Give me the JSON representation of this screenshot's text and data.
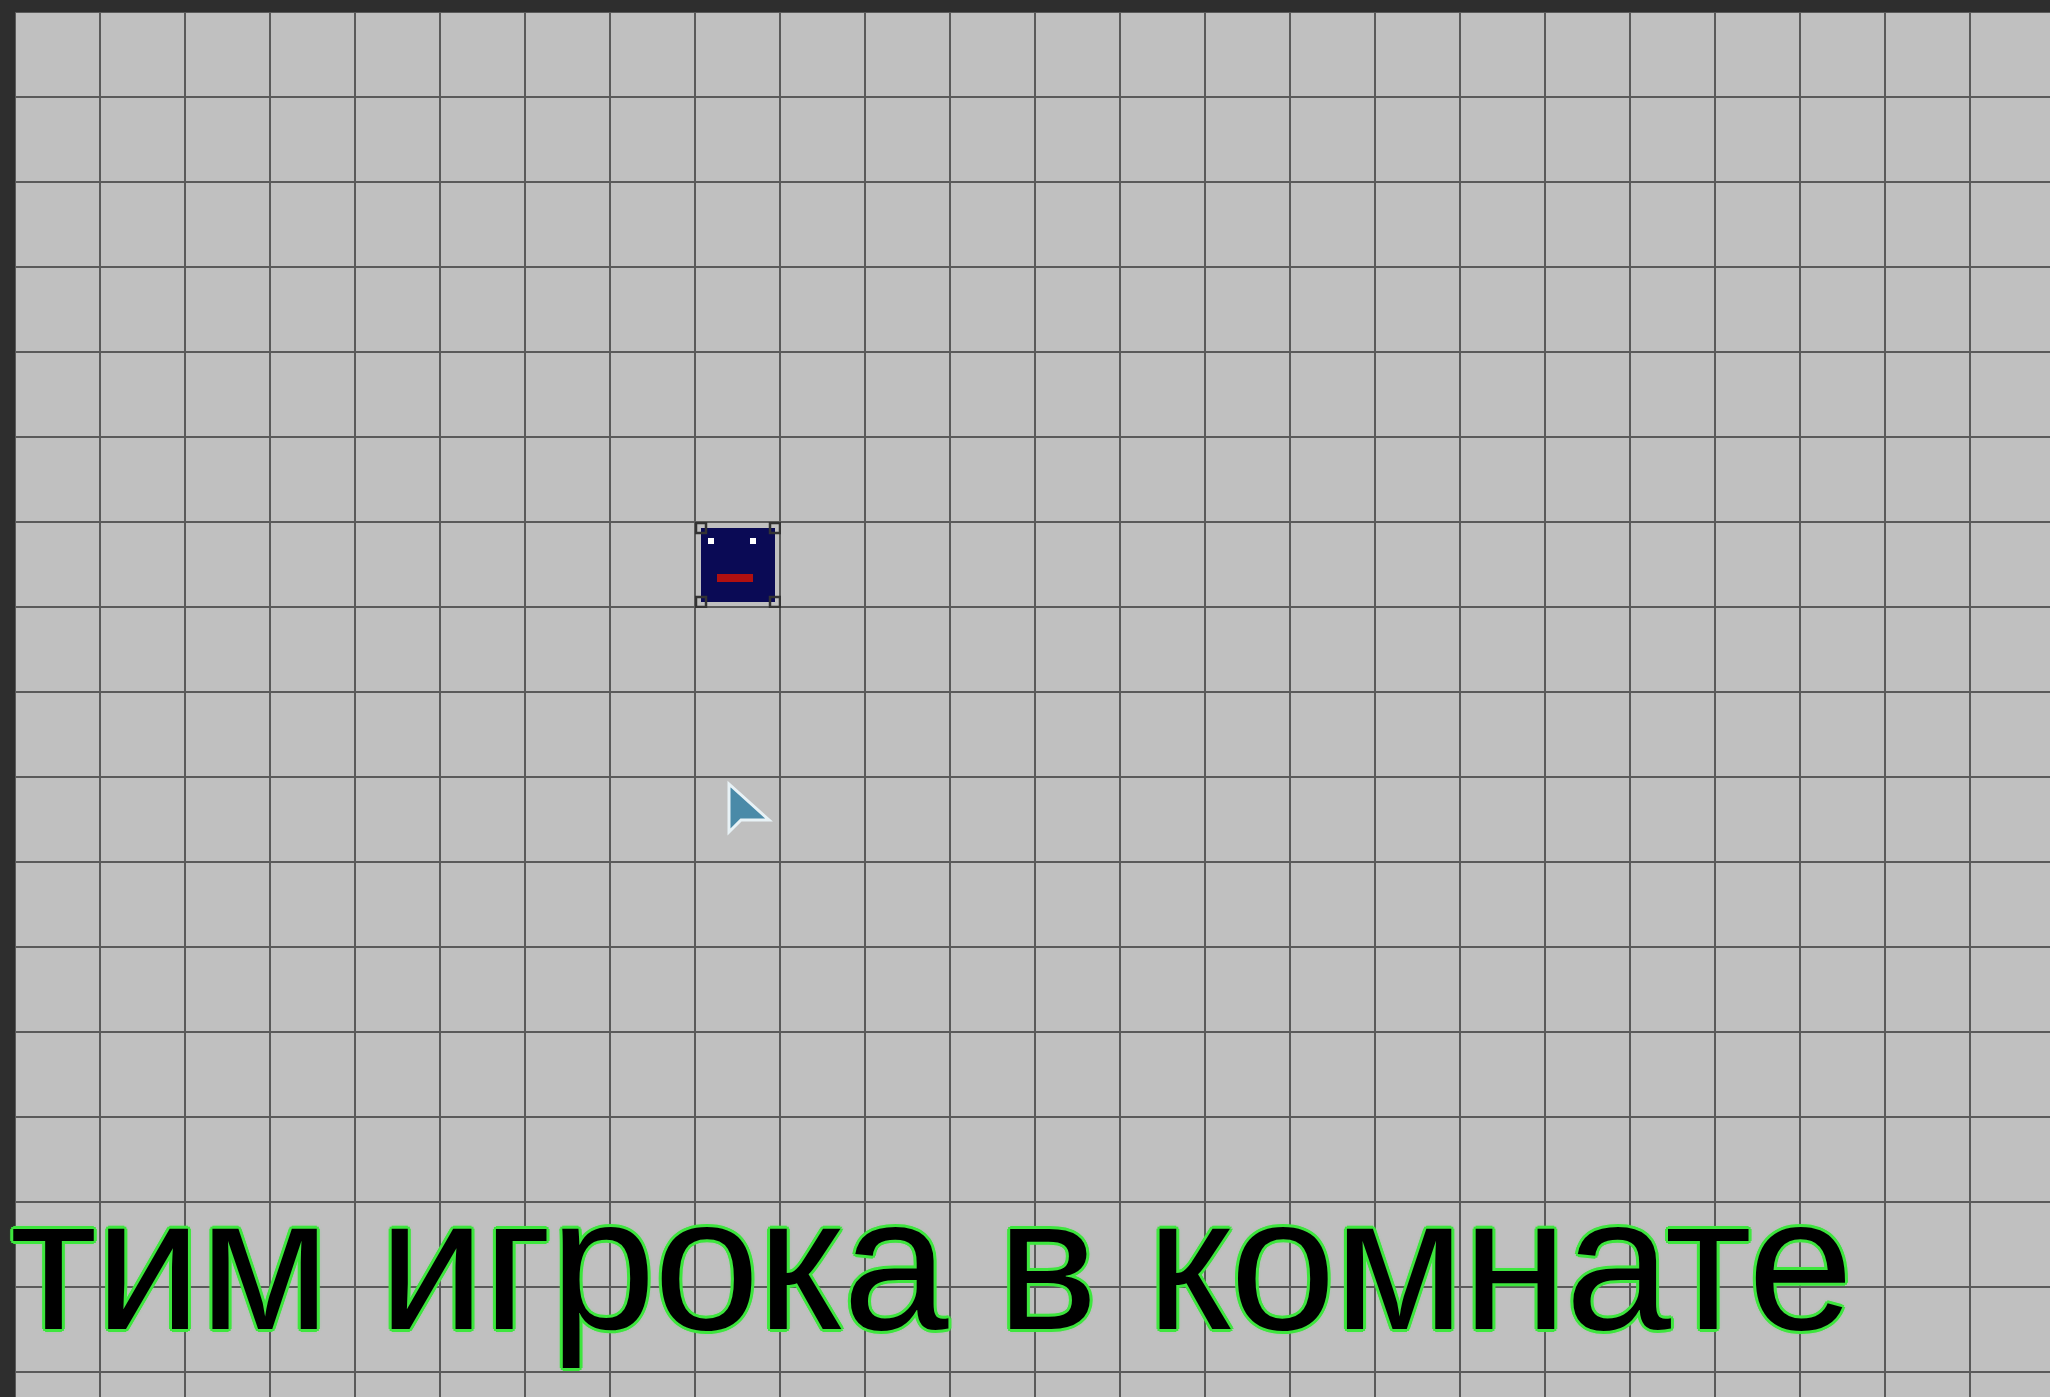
{
  "room": {
    "instances": [
      {
        "kind": "sprite",
        "selected": true
      }
    ]
  },
  "cursor": {
    "kind": "arrow"
  },
  "subtitle": "тим игрока в комнате"
}
